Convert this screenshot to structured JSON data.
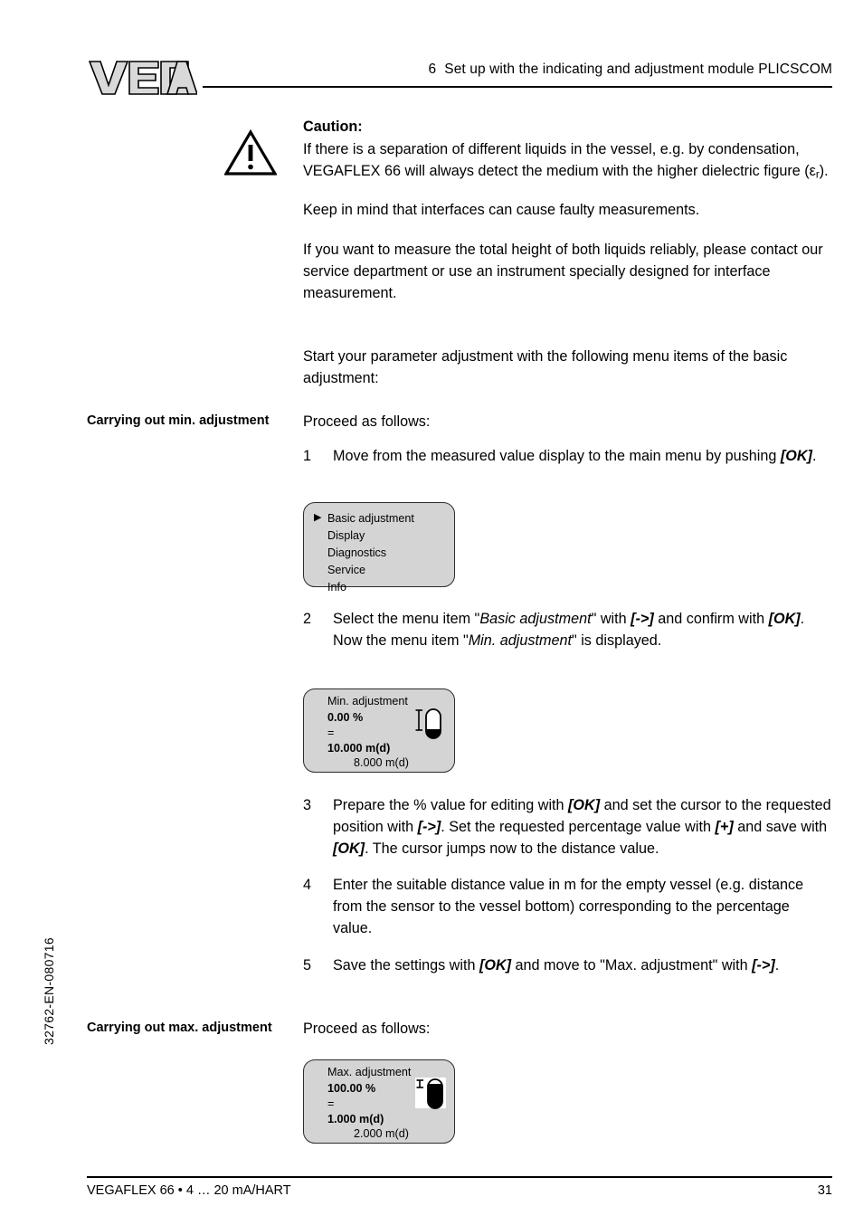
{
  "header": {
    "logo_text": "VEGA",
    "chapter_number": "6",
    "chapter_title": "Set up with the indicating and adjustment module PLICSCOM"
  },
  "caution": {
    "icon": "warning-triangle-icon",
    "title": "Caution:",
    "body": "If there is a separation of different liquids in the vessel, e.g. by condensation, VEGAFLEX 66 will always detect the medium with the higher dielectric figure (εr)."
  },
  "paragraphs": {
    "interfaces": "Keep in mind that interfaces can cause faulty measurements.",
    "service": "If you want to measure the total height of both liquids reliably, please contact our service department or use an instrument specially designed for interface measurement.",
    "start": "Start your parameter adjustment with the following menu items of the basic adjustment:"
  },
  "min_section": {
    "margin_heading": "Carrying out min. adjustment",
    "intro": "Proceed as follows:",
    "steps": [
      {
        "num": "1",
        "text": "Move from the measured value display to the main menu by pushing [OK]."
      },
      {
        "num": "2",
        "text": "Select the menu item \"Basic adjustment\" with [->] and confirm with [OK]. Now the menu item \"Min. adjustment\" is displayed."
      },
      {
        "num": "3",
        "text": "Prepare the % value for editing with [OK] and set the cursor to the requested position with [->]. Set the requested percentage value with [+] and save with [OK]. The cursor jumps now to the distance value."
      },
      {
        "num": "4",
        "text": "Enter the suitable distance value in m for the empty vessel (e.g. distance from the sensor to the vessel bottom) corresponding to the percentage value."
      },
      {
        "num": "5",
        "text": "Save the settings with [OK] and move to \"Max. adjustment\" with [->]."
      }
    ]
  },
  "menu_display": {
    "items": [
      {
        "label": "Basic adjustment",
        "selected": true,
        "arrow": "▶"
      },
      {
        "label": "Display",
        "selected": false,
        "arrow": ""
      },
      {
        "label": "Diagnostics",
        "selected": false,
        "arrow": ""
      },
      {
        "label": "Service",
        "selected": false,
        "arrow": ""
      },
      {
        "label": "Info",
        "selected": false,
        "arrow": ""
      }
    ]
  },
  "min_display": {
    "title": "Min. adjustment",
    "percent": "0.00 %",
    "equals": "=",
    "distance": "10.000 m(d)",
    "current": "8.000 m(d)",
    "icon": "vessel-empty-icon"
  },
  "max_section": {
    "margin_heading": "Carrying out max. adjustment",
    "intro": "Proceed as follows:"
  },
  "max_display": {
    "title": "Max. adjustment",
    "percent": "100.00 %",
    "equals": "=",
    "distance": "1.000 m(d)",
    "current": "2.000 m(d)",
    "icon": "vessel-full-icon"
  },
  "side_code": "32762-EN-080716",
  "footer": {
    "left": "VEGAFLEX 66 • 4 … 20 mA/HART",
    "page": "31"
  }
}
